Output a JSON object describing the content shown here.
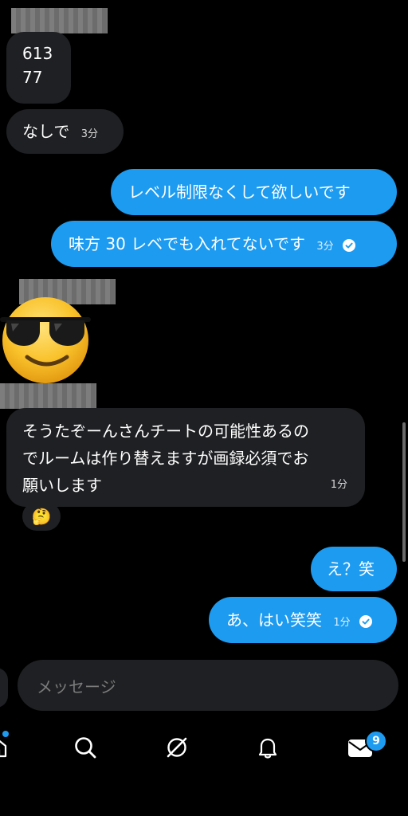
{
  "messages": {
    "m1": {
      "line1": "613",
      "line2": "77"
    },
    "m2": {
      "text": "なしで",
      "time": "3分"
    },
    "m3": {
      "text": "レベル制限なくして欲しいです"
    },
    "m4": {
      "text": "味方 30 レベでも入れてないです",
      "time": "3分"
    },
    "m5": {
      "line1": "そうたぞーんさんチートの可能性あるの",
      "line2": "でルームは作り替えますが画録必須でお",
      "line3": "願いします",
      "time": "1分"
    },
    "m6": {
      "text": "え？笑"
    },
    "m7": {
      "text": "あ、はい笑笑",
      "time": "1分"
    }
  },
  "reaction": {
    "emoji": "🤔"
  },
  "composer": {
    "placeholder": "メッセージ"
  },
  "tabbar": {
    "items": [
      "home-icon",
      "search-icon",
      "grok-icon",
      "notifications-icon",
      "messages-icon"
    ],
    "messages_badge": "9"
  },
  "colors": {
    "accent": "#1d9bf0",
    "incoming_bubble": "#1f2023",
    "background": "#000000"
  }
}
